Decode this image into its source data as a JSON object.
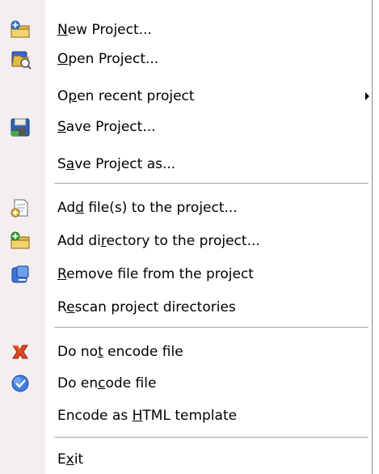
{
  "menu": {
    "items": [
      {
        "label": "New Project...",
        "mnemonic_index": 0,
        "icon": "new-project-icon"
      },
      {
        "label": "Open Project...",
        "mnemonic_index": 0,
        "icon": "open-project-icon"
      },
      {
        "label": "Open recent project",
        "mnemonic_index": 1,
        "icon": "",
        "submenu": true
      },
      {
        "label": "Save Project...",
        "mnemonic_index": 0,
        "icon": "save-project-icon"
      },
      {
        "label": "Save Project as...",
        "mnemonic_index": 1,
        "icon": ""
      },
      {
        "label": "Add file(s) to the project...",
        "mnemonic_index": 2,
        "icon": "add-file-icon"
      },
      {
        "label": "Add directory to the project...",
        "mnemonic_index": 6,
        "icon": "add-directory-icon"
      },
      {
        "label": "Remove file from the project",
        "mnemonic_index": 0,
        "icon": "remove-file-icon"
      },
      {
        "label": "Rescan project directories",
        "mnemonic_index": 1,
        "icon": ""
      },
      {
        "label": "Do not encode file",
        "mnemonic_index": 5,
        "icon": "do-not-encode-icon"
      },
      {
        "label": "Do encode file",
        "mnemonic_index": 5,
        "icon": "do-encode-icon"
      },
      {
        "label": "Encode as HTML template",
        "mnemonic_index": 10,
        "icon": ""
      },
      {
        "label": "Exit",
        "mnemonic_index": 1,
        "icon": ""
      }
    ]
  },
  "colors": {
    "gutter": "#f4eef0",
    "separator": "#a6a6a6",
    "border": "#8c8c8c"
  }
}
